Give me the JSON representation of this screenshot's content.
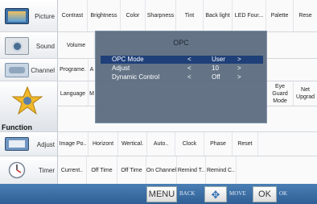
{
  "categories": {
    "picture": {
      "label": "Picture",
      "options": [
        "Contrast",
        "Brightness",
        "Color",
        "Sharpness",
        "Tint",
        "Back light",
        "LED Four...",
        "Palette",
        "Rese"
      ]
    },
    "sound": {
      "label": "Sound",
      "options": [
        "Volume"
      ]
    },
    "channel": {
      "label": "Channel",
      "options": [
        "Programe.",
        "A"
      ]
    },
    "function": {
      "label": "Function",
      "options": [
        "Language",
        "M"
      ],
      "right_options": [
        "Eye Guard Mode",
        "Net Upgrad"
      ]
    },
    "adjust": {
      "label": "Adjust",
      "options": [
        "Image Po..",
        "Horizont",
        "Wertical.",
        "Auto..",
        "Clock",
        "Phase",
        "Reset"
      ]
    },
    "timer": {
      "label": "Timer",
      "options": [
        "Current..",
        "Off Time",
        "Off Time",
        "On Channel",
        "Remind T..",
        "Remind C.."
      ]
    }
  },
  "osd": {
    "title": "OPC",
    "rows": [
      {
        "name": "OPC  Mode",
        "left": "<",
        "value": "User",
        "right": ">"
      },
      {
        "name": "Adjust",
        "left": "<",
        "value": "10",
        "right": ">"
      },
      {
        "name": "Dynamic Control",
        "left": "<",
        "value": "Off",
        "right": ">"
      }
    ]
  },
  "bottom_bar": {
    "menu_label": "MENU",
    "back_hint": "BACK",
    "move_hint": "MOVE",
    "ok_label": "OK",
    "ok_hint": "OK"
  },
  "icons": [
    "picture-icon",
    "sound-icon",
    "channel-icon",
    "function-icon",
    "adjust-icon",
    "timer-icon",
    "move-arrows-icon"
  ],
  "colors": {
    "selected_row": "#1f3f78",
    "bottom_bar": "#3b6ea5",
    "osd_bg": "#58697d"
  }
}
